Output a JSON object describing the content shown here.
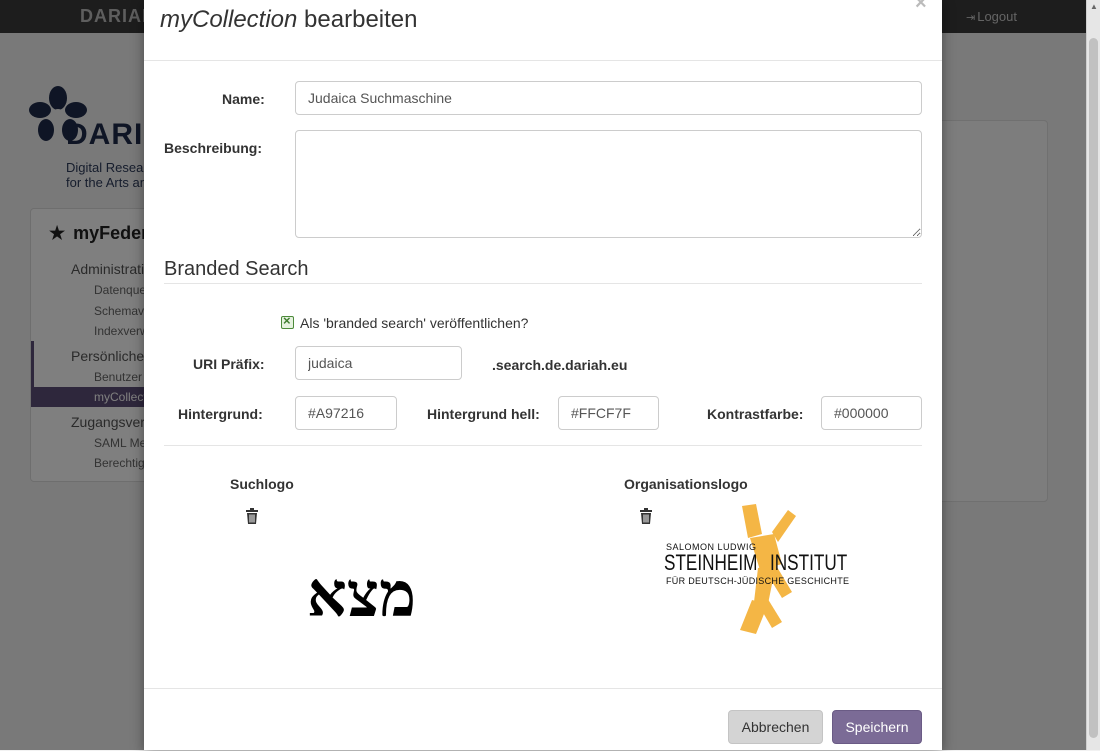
{
  "background": {
    "brand": "DARIAH",
    "logout_label": "Logout",
    "logo_word": "DARIAH",
    "logo_sub_line1": "Digital Research Infrastructure",
    "logo_sub_line2": "for the Arts and Humanities",
    "sidebar": {
      "title": "myFederation",
      "sections": [
        {
          "label": "Administration",
          "items": [
            "Datenquellen",
            "Schemaverwaltung",
            "Indexverwaltung"
          ]
        },
        {
          "label": "Persönliches",
          "items": [
            "Benutzer",
            "myCollections"
          ]
        },
        {
          "label": "Zugangsverwaltung",
          "items": [
            "SAML Metadaten",
            "Berechtigungen"
          ]
        }
      ],
      "active_item": "myCollections"
    }
  },
  "modal": {
    "title_italic": "myCollection",
    "title_rest": " bearbeiten",
    "close_label": "×",
    "name": {
      "label": "Name:",
      "value": "Judaica Suchmaschine"
    },
    "description": {
      "label": "Beschreibung:",
      "value": ""
    },
    "branded_search": {
      "heading": "Branded Search",
      "publish_label": "Als 'branded search' veröffentlichen?",
      "publish_checked": true,
      "uri_label": "URI Präfix:",
      "uri_value": "judaica",
      "uri_suffix": ".search.de.dariah.eu",
      "bg_label": "Hintergrund:",
      "bg_value": "#A97216",
      "bg_light_label": "Hintergrund hell:",
      "bg_light_value": "#FFCF7F",
      "contrast_label": "Kontrastfarbe:",
      "contrast_value": "#000000"
    },
    "suchlogo": {
      "heading": "Suchlogo",
      "text": "מצא",
      "delete_icon": "trash-icon"
    },
    "orglogo": {
      "heading": "Organisationslogo",
      "line1": "SALOMON LUDWIG",
      "line2_left": "STEINHEIM",
      "line2_right": "INSTITUT",
      "line3": "FÜR DEUTSCH-JÜDISCHE GESCHICHTE",
      "delete_icon": "trash-icon"
    },
    "footer": {
      "cancel_label": "Abbrechen",
      "save_label": "Speichern"
    }
  },
  "colors": {
    "primary_button": "#7b6b96",
    "checkbox_green": "#4c8a3a",
    "logo_orange": "#F4B036",
    "topbar": "#3b3b3b"
  }
}
